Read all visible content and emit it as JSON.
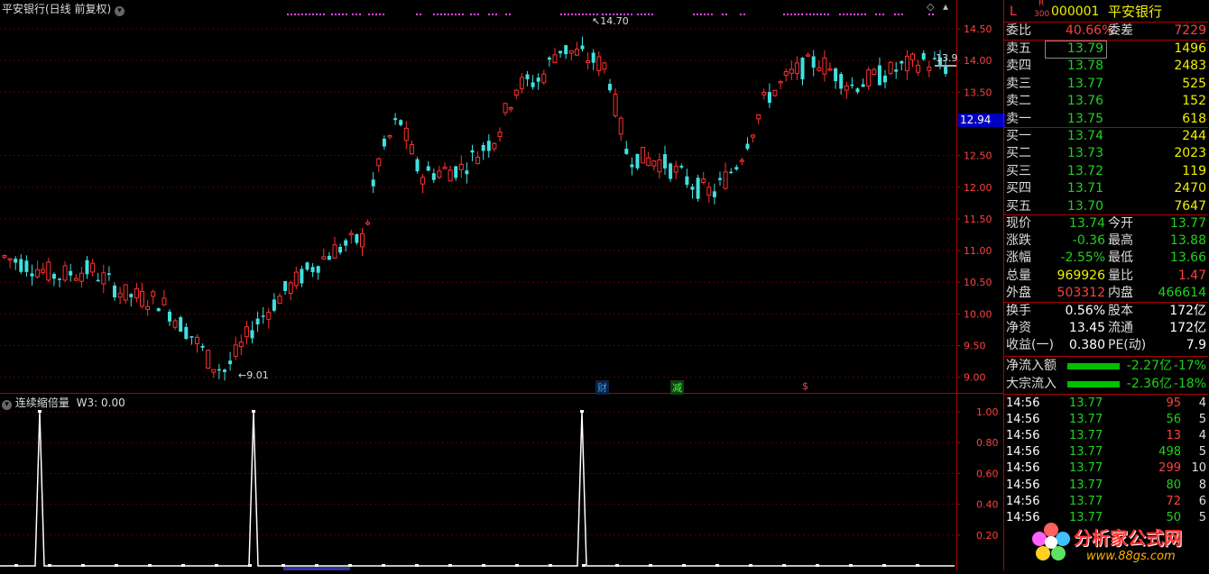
{
  "main_chart": {
    "title": "平安银行(日线 前复权)",
    "high_label": "14.70",
    "low_label": "9.01",
    "last_price_tag": "13.9",
    "cursor_price": "12.94",
    "y_ticks": [
      "14.50",
      "14.00",
      "13.50",
      "12.50",
      "12.00",
      "11.50",
      "11.00",
      "10.50",
      "10.00",
      "9.50",
      "9.00"
    ],
    "event_markers": [
      "财",
      "减",
      "$"
    ]
  },
  "indicator": {
    "title": "连续缩倍量",
    "value_label": "W3: 0.00",
    "y_ticks": [
      "1.00",
      "0.80",
      "0.60",
      "0.40",
      "0.20"
    ]
  },
  "quote": {
    "market_flag": "L",
    "index_flag_top": "R",
    "index_flag_bottom": "300",
    "code": "000001",
    "name": "平安银行",
    "ratio_label": "委比",
    "ratio_value": "40.66%",
    "diff_label": "委差",
    "diff_value": "7229",
    "asks": [
      {
        "label": "卖五",
        "price": "13.79",
        "vol": "1496"
      },
      {
        "label": "卖四",
        "price": "13.78",
        "vol": "2483"
      },
      {
        "label": "卖三",
        "price": "13.77",
        "vol": "525"
      },
      {
        "label": "卖二",
        "price": "13.76",
        "vol": "152"
      },
      {
        "label": "卖一",
        "price": "13.75",
        "vol": "618"
      }
    ],
    "bids": [
      {
        "label": "买一",
        "price": "13.74",
        "vol": "244"
      },
      {
        "label": "买二",
        "price": "13.73",
        "vol": "2023"
      },
      {
        "label": "买三",
        "price": "13.72",
        "vol": "119"
      },
      {
        "label": "买四",
        "price": "13.71",
        "vol": "2470"
      },
      {
        "label": "买五",
        "price": "13.70",
        "vol": "7647"
      }
    ],
    "stats": [
      {
        "l1": "现价",
        "v1": "13.74",
        "l2": "今开",
        "v2": "13.77"
      },
      {
        "l1": "涨跌",
        "v1": "-0.36",
        "l2": "最高",
        "v2": "13.88"
      },
      {
        "l1": "涨幅",
        "v1": "-2.55%",
        "l2": "最低",
        "v2": "13.66"
      },
      {
        "l1": "总量",
        "v1": "969926",
        "l2": "量比",
        "v2": "1.47"
      },
      {
        "l1": "外盘",
        "v1": "503312",
        "l2": "内盘",
        "v2": "466614"
      }
    ],
    "fin": [
      {
        "l1": "换手",
        "v1": "0.56%",
        "l2": "股本",
        "v2": "172亿"
      },
      {
        "l1": "净资",
        "v1": "13.45",
        "l2": "流通",
        "v2": "172亿"
      },
      {
        "l1": "收益(一)",
        "v1": "0.380",
        "l2": "PE(动)",
        "v2": "7.9"
      }
    ],
    "flows": [
      {
        "label": "净流入额",
        "amount": "-2.27亿",
        "pct": "-17%"
      },
      {
        "label": "大宗流入",
        "amount": "-2.36亿",
        "pct": "-18%"
      }
    ],
    "ticks": [
      {
        "time": "14:56",
        "price": "13.77",
        "vol": "95",
        "n": "4"
      },
      {
        "time": "14:56",
        "price": "13.77",
        "vol": "56",
        "n": "5"
      },
      {
        "time": "14:56",
        "price": "13.77",
        "vol": "13",
        "n": "4"
      },
      {
        "time": "14:56",
        "price": "13.77",
        "vol": "498",
        "n": "5"
      },
      {
        "time": "14:56",
        "price": "13.77",
        "vol": "299",
        "n": "10"
      },
      {
        "time": "14:56",
        "price": "13.77",
        "vol": "80",
        "n": "8"
      },
      {
        "time": "14:56",
        "price": "13.77",
        "vol": "72",
        "n": "6"
      },
      {
        "time": "14:56",
        "price": "13.77",
        "vol": "50",
        "n": "5"
      }
    ]
  },
  "watermark": {
    "title": "分析家公式网",
    "url": "www.88gs.com"
  },
  "colors": {
    "up": "#ff3030",
    "down": "#40e0e0",
    "frame": "#b00000",
    "cursor_bg": "#0000c0",
    "magenta": "#ff40ff"
  }
}
